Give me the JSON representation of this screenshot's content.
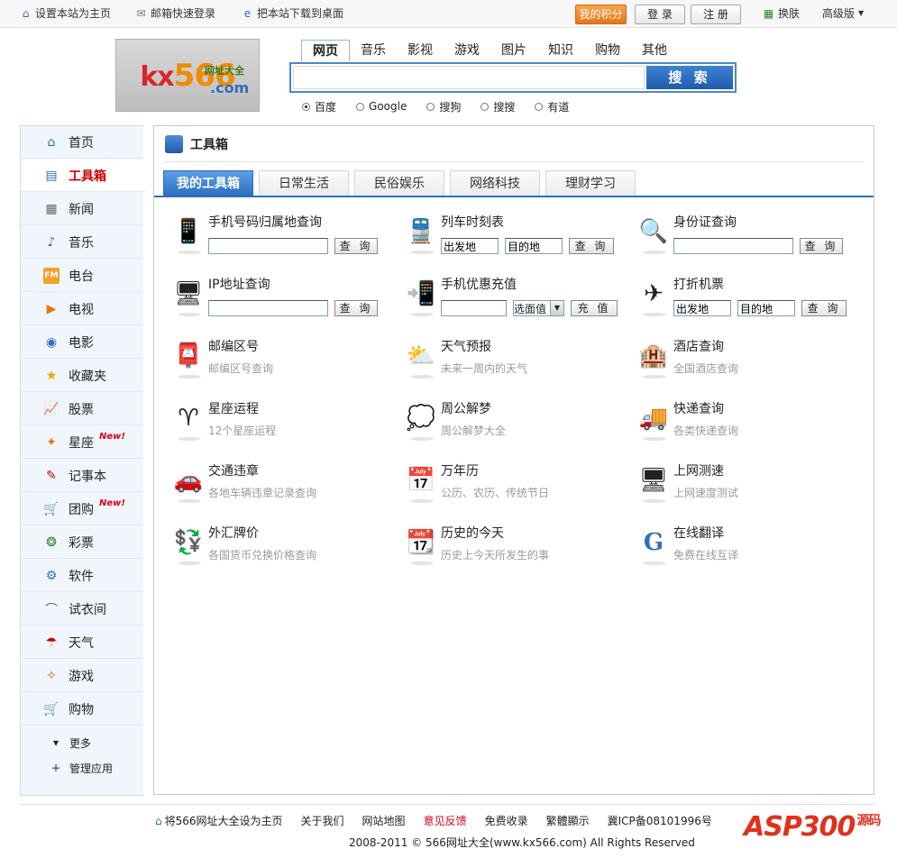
{
  "topbar": {
    "set_home": "设置本站为主页",
    "mail_login": "邮箱快速登录",
    "download_desktop": "把本站下载到桌面",
    "my_points": "我的积分",
    "login": "登 录",
    "register": "注 册",
    "skin": "换肤",
    "advanced": "高级版"
  },
  "logo": {
    "mark": "566",
    "sub": "网址大全",
    "com": ".com",
    "k": "kx"
  },
  "search": {
    "tabs": [
      "网页",
      "音乐",
      "影视",
      "游戏",
      "图片",
      "知识",
      "购物",
      "其他"
    ],
    "active_tab": 0,
    "query": "",
    "button": "搜 索",
    "engines": [
      "百度",
      "Google",
      "搜狗",
      "搜搜",
      "有道"
    ],
    "selected_engine": 0
  },
  "sidebar": {
    "items": [
      {
        "label": "首页",
        "icon": "home-icon",
        "glyph": "⌂",
        "color": "#2d6ec1"
      },
      {
        "label": "工具箱",
        "icon": "toolbox-icon",
        "glyph": "▤",
        "color": "#2d6ec1",
        "active": true
      },
      {
        "label": "新闻",
        "icon": "news-icon",
        "glyph": "▦",
        "color": "#666"
      },
      {
        "label": "音乐",
        "icon": "music-icon",
        "glyph": "♪",
        "color": "#2d6ec1"
      },
      {
        "label": "电台",
        "icon": "radio-fm-icon",
        "glyph": "FM",
        "color": "#e07a10"
      },
      {
        "label": "电视",
        "icon": "tv-icon",
        "glyph": "▶",
        "color": "#e07a10"
      },
      {
        "label": "电影",
        "icon": "movie-icon",
        "glyph": "◉",
        "color": "#2d6ec1"
      },
      {
        "label": "收藏夹",
        "icon": "favorites-star-icon",
        "glyph": "★",
        "color": "#e8a400"
      },
      {
        "label": "股票",
        "icon": "stock-chart-icon",
        "glyph": "📈",
        "color": "#c00"
      },
      {
        "label": "星座",
        "icon": "zodiac-icon",
        "glyph": "✦",
        "color": "#e07a10",
        "new": "New!"
      },
      {
        "label": "记事本",
        "icon": "notepad-pen-icon",
        "glyph": "✎",
        "color": "#c00"
      },
      {
        "label": "团购",
        "icon": "group-buy-cart-icon",
        "glyph": "🛒",
        "color": "#c00",
        "new": "New!"
      },
      {
        "label": "彩票",
        "icon": "lottery-ball-icon",
        "glyph": "❂",
        "color": "#2a8a2a"
      },
      {
        "label": "软件",
        "icon": "software-icon",
        "glyph": "⚙",
        "color": "#2d6ec1"
      },
      {
        "label": "试衣间",
        "icon": "hanger-icon",
        "glyph": "⌒",
        "color": "#555"
      },
      {
        "label": "天气",
        "icon": "weather-balloon-icon",
        "glyph": "☂",
        "color": "#c00"
      },
      {
        "label": "游戏",
        "icon": "game-icon",
        "glyph": "✧",
        "color": "#b07a00"
      },
      {
        "label": "购物",
        "icon": "shopping-cart-icon",
        "glyph": "🛒",
        "color": "#2a8a2a"
      }
    ],
    "more": "更多",
    "manage": "管理应用"
  },
  "main": {
    "title": "工具箱",
    "tabs": [
      "我的工具箱",
      "日常生活",
      "民俗娱乐",
      "网络科技",
      "理财学习"
    ],
    "active_tab": 0,
    "query_btn": "查 询",
    "recharge_btn": "充 值",
    "from_ph": "出发地",
    "to_ph": "目的地",
    "select_face": "选面值",
    "tools": [
      {
        "name": "手机号码归属地查询",
        "icon": "mobile-phone-icon",
        "glyph": "📱",
        "type": "input"
      },
      {
        "name": "列车时刻表",
        "icon": "train-icon",
        "glyph": "🚆",
        "type": "route"
      },
      {
        "name": "身份证查询",
        "icon": "id-card-search-icon",
        "glyph": "🔍",
        "type": "input"
      },
      {
        "name": "IP地址查询",
        "icon": "ip-monitor-icon",
        "glyph": "🖥",
        "type": "input"
      },
      {
        "name": "手机优惠充值",
        "icon": "phone-recharge-icon",
        "glyph": "📲",
        "type": "recharge"
      },
      {
        "name": "打折机票",
        "icon": "plane-ticket-icon",
        "glyph": "✈",
        "type": "route"
      },
      {
        "name": "邮编区号",
        "icon": "postcode-icon",
        "glyph": "📮",
        "desc": "邮编区号查询"
      },
      {
        "name": "天气预报",
        "icon": "weather-sun-cloud-icon",
        "glyph": "⛅",
        "desc": "未来一周内的天气"
      },
      {
        "name": "酒店查询",
        "icon": "hotel-building-icon",
        "glyph": "🏨",
        "desc": "全国酒店查询"
      },
      {
        "name": "星座运程",
        "icon": "aries-zodiac-icon",
        "glyph": "♈",
        "desc": "12个星座运程"
      },
      {
        "name": "周公解梦",
        "icon": "dream-person-icon",
        "glyph": "💭",
        "desc": "周公解梦大全"
      },
      {
        "name": "快递查询",
        "icon": "express-truck-icon",
        "glyph": "🚚",
        "desc": "各类快递查询"
      },
      {
        "name": "交通违章",
        "icon": "traffic-violation-icon",
        "glyph": "🚗",
        "desc": "各地车辆违章记录查询"
      },
      {
        "name": "万年历",
        "icon": "calendar-15-icon",
        "glyph": "📅",
        "desc": "公历、农历、传统节日"
      },
      {
        "name": "上网测速",
        "icon": "speed-test-monitor-icon",
        "glyph": "🖥",
        "desc": "上网速度测试"
      },
      {
        "name": "外汇牌价",
        "icon": "currency-exchange-icon",
        "glyph": "💱",
        "desc": "各国货币兑换价格查询"
      },
      {
        "name": "历史的今天",
        "icon": "history-calendar-icon",
        "glyph": "📆",
        "desc": "历史上今天所发生的事"
      },
      {
        "name": "在线翻译",
        "icon": "translate-g-icon",
        "glyph": "G",
        "desc": "免费在线互译"
      }
    ]
  },
  "footer": {
    "links": [
      "将566网址大全设为主页",
      "关于我们",
      "网站地图",
      "意见反馈",
      "免费收录",
      "繁體顯示",
      "冀ICP备08101996号"
    ],
    "highlight_index": 3,
    "copyright": "2008-2011 © 566网址大全(www.kx566.com) All Rights Reserved",
    "watermark": "ASP300",
    "watermark_sub": "源码"
  }
}
